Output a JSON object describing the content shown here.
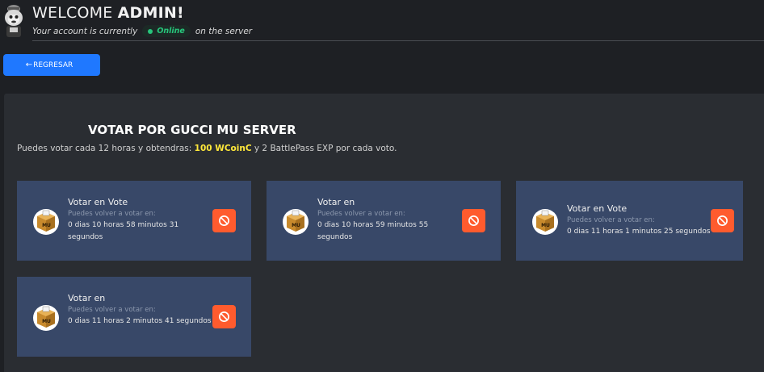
{
  "header": {
    "welcome_prefix": "WELCOME",
    "welcome_name": "ADMIN!",
    "status_prefix": "Your account is currently",
    "status_badge": "Online",
    "status_suffix": "on the server"
  },
  "back_button": {
    "label": "REGRESAR",
    "icon": "arrow-left-icon"
  },
  "panel": {
    "title": "VOTAR POR GUCCI MU SERVER",
    "desc_prefix": "Puedes votar cada 12 horas y obtendras:",
    "desc_reward": "100 WCoinC",
    "desc_suffix": "y 2 BattlePass EXP por cada voto."
  },
  "cards": [
    {
      "name": "Votar en Vote",
      "sub": "Puedes volver a votar en:",
      "time": "0 dias 10 horas 58 minutos 31 segundos"
    },
    {
      "name": "Votar en",
      "sub": "Puedes volver a votar en:",
      "time": "0 dias 10 horas 59 minutos 55 segundos"
    },
    {
      "name": "Votar en Vote",
      "sub": "Puedes volver a votar en:",
      "time": "0 dias 11 horas 1 minutos 25 segundos"
    },
    {
      "name": "Votar en",
      "sub": "Puedes volver a votar en:",
      "time": "0 dias 11 horas 2 minutos 41 segundos"
    }
  ],
  "colors": {
    "accent": "#1f78ff",
    "online": "#27c57b",
    "card_bg": "#384868",
    "block_button": "#ff5b2e",
    "highlight": "#ffe83a"
  },
  "icons": {
    "avatar": "monkey-avatar-icon",
    "vote_box": "ballot-box-icon",
    "block": "blocked-icon"
  }
}
